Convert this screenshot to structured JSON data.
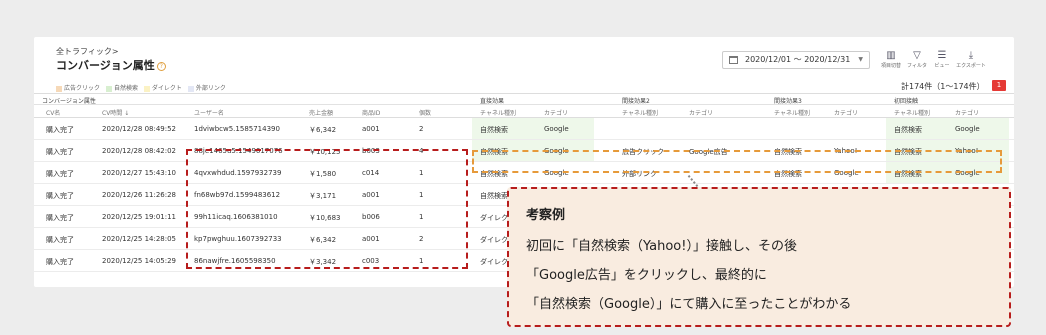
{
  "breadcrumb": "全トラフィック>",
  "title": "コンバージョン属性",
  "help_icon": "?",
  "date_range": "2020/12/01 ～ 2020/12/31",
  "toolbar": [
    {
      "label": "項目切替",
      "icon": "columns-icon"
    },
    {
      "label": "フィルタ",
      "icon": "filter-icon"
    },
    {
      "label": "ビュー",
      "icon": "view-icon"
    },
    {
      "label": "エクスポート",
      "icon": "export-icon"
    }
  ],
  "legend": [
    {
      "label": "広告クリック",
      "color": "#f6d9b8"
    },
    {
      "label": "自然検索",
      "color": "#d8efd0"
    },
    {
      "label": "ダイレクト",
      "color": "#fbf2c4"
    },
    {
      "label": "外部リンク",
      "color": "#e3e7f5"
    }
  ],
  "total": "計174件（1～174件）",
  "page_button": "1",
  "groups": [
    "コンバージョン属性",
    "直接効果",
    "間接効果2",
    "間接効果3",
    "初回接触"
  ],
  "columns": [
    "CV名",
    "CV時間 ↓",
    "ユーザー名",
    "売上金額",
    "商品ID",
    "個数",
    "チャネル種別",
    "カテゴリ",
    "チャネル種別",
    "カテゴリ",
    "チャネル種別",
    "カテゴリ",
    "チャネル種別",
    "カテゴリ"
  ],
  "rows": [
    [
      "購入完了",
      "2020/12/28 08:49:52",
      "1dviwbcw5.1585714390",
      "￥6,342",
      "a001",
      "2",
      "自然検索",
      "Google",
      "",
      "",
      "",
      "",
      "自然検索",
      "Google"
    ],
    [
      "購入完了",
      "2020/12/28 08:42:02",
      "88je1465u5.1549617076",
      "￥10,125",
      "b003",
      "4",
      "自然検索",
      "Google",
      "広告クリック",
      "Google広告",
      "自然検索",
      "Yahoo!",
      "自然検索",
      "Yahoo!"
    ],
    [
      "購入完了",
      "2020/12/27 15:43:10",
      "4qvxwhdud.1597932739",
      "￥1,580",
      "c014",
      "1",
      "自然検索",
      "Google",
      "外部リンク",
      "",
      "自然検索",
      "Google",
      "自然検索",
      "Google"
    ],
    [
      "購入完了",
      "2020/12/26 11:26:28",
      "fn68wb97d.1599483612",
      "￥3,171",
      "a001",
      "1",
      "自然検索",
      "",
      "",
      "",
      "",
      "",
      "",
      ""
    ],
    [
      "購入完了",
      "2020/12/25 19:01:11",
      "99h11icaq.1606381010",
      "￥10,683",
      "b006",
      "1",
      "ダイレクト",
      "",
      "",
      "",
      "",
      "",
      "",
      ""
    ],
    [
      "購入完了",
      "2020/12/25 14:28:05",
      "kp7pwghuu.1607392733",
      "￥6,342",
      "a001",
      "2",
      "ダイレク",
      "",
      "",
      "",
      "",
      "",
      "",
      ""
    ],
    [
      "購入完了",
      "2020/12/25 14:05:29",
      "86nawjfre.1605598350",
      "￥3,342",
      "c003",
      "1",
      "ダイレク",
      "",
      "",
      "",
      "",
      "",
      "",
      ""
    ]
  ],
  "callout": {
    "title": "考察例",
    "lines": [
      "初回に「自然検索（Yahoo!）」接触し、その後",
      "「Google広告」をクリックし、最終的に",
      "「自然検索（Google）」にて購入に至ったことがわかる"
    ]
  },
  "colors": {
    "highlight": "#eef8ea",
    "red": "#b71c1c",
    "orange": "#e69a3a",
    "callout_bg": "#f9ece0",
    "page_button": "#e53935"
  }
}
